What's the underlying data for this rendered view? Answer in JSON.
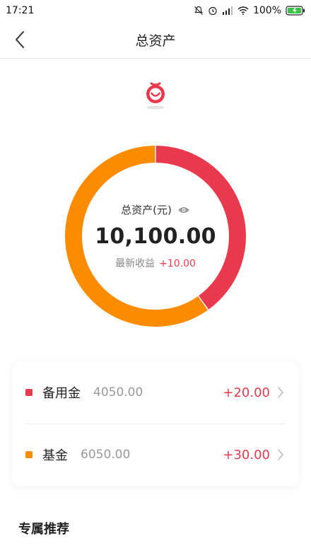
{
  "status_bar": {
    "time": "17:21",
    "battery": "100%",
    "icons": [
      "mute-bell-icon",
      "alarm-icon",
      "signal-icon",
      "wifi-icon",
      "battery-charging-icon"
    ]
  },
  "header": {
    "title": "总资产",
    "back_icon": "chevron-left-icon"
  },
  "summary": {
    "total_label": "总资产(元)",
    "total_value": "10,100.00",
    "income_label": "最新收益",
    "income_value": "+10.00"
  },
  "colors": {
    "reserve": "#e8394d",
    "fund": "#fb8c00",
    "accent_red": "#e8394d"
  },
  "assets": [
    {
      "name": "备用金",
      "amount": "4050.00",
      "gain": "+20.00",
      "color": "#e8394d"
    },
    {
      "name": "基金",
      "amount": "6050.00",
      "gain": "+30.00",
      "color": "#fb8c00"
    }
  ],
  "chart_data": {
    "type": "pie",
    "series": [
      {
        "name": "备用金",
        "value": 4050
      },
      {
        "name": "基金",
        "value": 6050
      }
    ]
  },
  "recommend": {
    "title": "专属推荐"
  }
}
